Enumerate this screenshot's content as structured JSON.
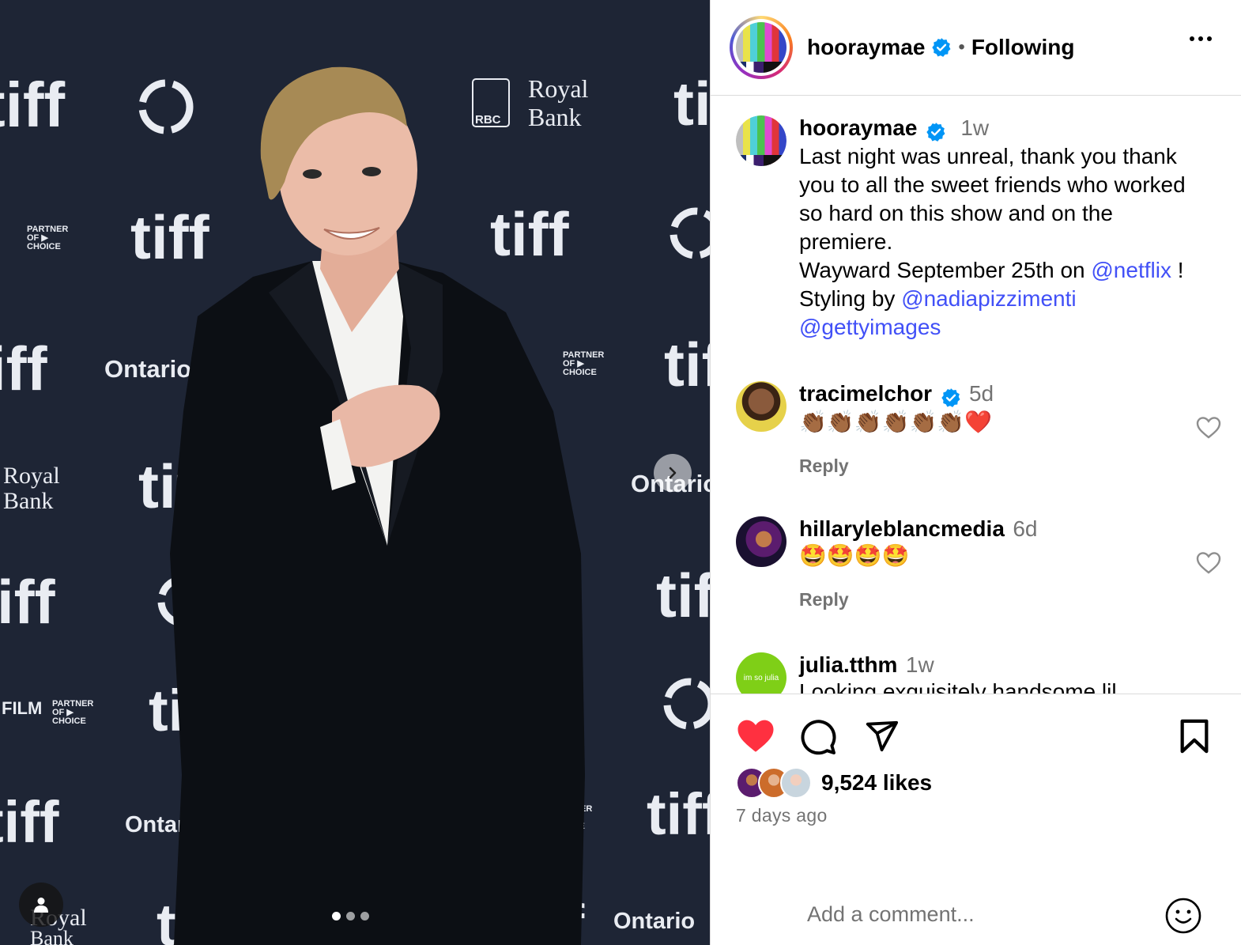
{
  "media": {
    "backdrop_words": {
      "tiff": "tiff",
      "ontario": "Ontario",
      "royal": "Royal",
      "bank": "Bank",
      "rbc": "RBC",
      "partner": "PARTNER",
      "of": "OF ▶",
      "choice": "CHOICE",
      "film": "FILM"
    },
    "carousel_dots": 3,
    "icons": {
      "next": "chevron-right-icon",
      "tagged_users": "user-icon"
    }
  },
  "header": {
    "username": "hooraymae",
    "separator": "•",
    "follow_status": "Following",
    "more_icon": "more-horizontal-icon"
  },
  "caption": {
    "username": "hooraymae",
    "time": "1w",
    "lines": [
      "Last night was unreal, thank you thank you to all the sweet friends who worked so hard on this show and on the premiere."
    ],
    "line2_prefix": "Wayward September 25th on",
    "line2_link": "@netflix",
    "line2_suffix": "!",
    "line3_prefix": "Styling by",
    "line3_link": "@nadiapizzimenti",
    "line4_link": "@gettyimages"
  },
  "comments": [
    {
      "username": "tracimelchor",
      "verified": true,
      "time": "5d",
      "text": "👏🏾👏🏾👏🏾👏🏾👏🏾👏🏾❤️",
      "reply": "Reply"
    },
    {
      "username": "hillaryleblancmedia",
      "verified": false,
      "time": "6d",
      "text": "🤩🤩🤩🤩",
      "reply": "Reply"
    },
    {
      "username": "julia.tthm",
      "verified": false,
      "time": "1w",
      "text": "Looking exquisitely handsome lil",
      "avatar_text": "im so julia"
    }
  ],
  "actions": {
    "liked": true,
    "like_color": "#ff3040",
    "likes": "9,524 likes",
    "date": "7 days ago"
  },
  "add_comment": {
    "placeholder": "Add a comment..."
  },
  "colors": {
    "link": "#4150f7",
    "verified": "#0095f6",
    "muted": "#737373",
    "divider": "#dbdbdb"
  }
}
